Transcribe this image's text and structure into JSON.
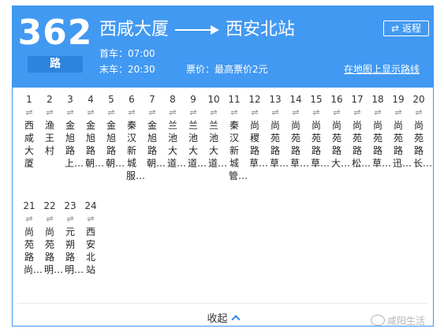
{
  "route": {
    "number": "362",
    "unit": "路"
  },
  "header": {
    "from": "西咸大厦",
    "to": "西安北站",
    "return_label": "返程",
    "return_icon": "swap-arrows-icon",
    "first_bus_label": "首车：",
    "first_bus_time": "07:00",
    "last_bus_label": "末车：",
    "last_bus_time": "20:30",
    "fare": "票价：最高票价2元",
    "map_link": "在地图上显示路线"
  },
  "stops": [
    {
      "num": "1",
      "dir": "⇌",
      "name": "西咸大厦"
    },
    {
      "num": "2",
      "dir": "⇌",
      "name": "渔王村"
    },
    {
      "num": "3",
      "dir": "⇌",
      "name": "金旭路上…"
    },
    {
      "num": "4",
      "dir": "⇌",
      "name": "金旭路朝…"
    },
    {
      "num": "5",
      "dir": "⇌",
      "name": "金旭路朝…"
    },
    {
      "num": "6",
      "dir": "⇌",
      "name": "秦汉新城服…"
    },
    {
      "num": "7",
      "dir": "⇌",
      "name": "金旭路朝…"
    },
    {
      "num": "8",
      "dir": "⇌",
      "name": "兰池大道…"
    },
    {
      "num": "9",
      "dir": "⇌",
      "name": "兰池大道…"
    },
    {
      "num": "10",
      "dir": "⇌",
      "name": "兰池大道…"
    },
    {
      "num": "11",
      "dir": "⇌",
      "name": "秦汉新城管…"
    },
    {
      "num": "12",
      "dir": "⇌",
      "name": "尚稷路草…"
    },
    {
      "num": "13",
      "dir": "⇌",
      "name": "尚苑路草…"
    },
    {
      "num": "14",
      "dir": "⇌",
      "name": "尚苑路草…"
    },
    {
      "num": "15",
      "dir": "⇌",
      "name": "尚苑路草…"
    },
    {
      "num": "16",
      "dir": "⇌",
      "name": "尚苑路大…"
    },
    {
      "num": "17",
      "dir": "⇌",
      "name": "尚苑路松…"
    },
    {
      "num": "18",
      "dir": "⇌",
      "name": "尚苑路草…"
    },
    {
      "num": "19",
      "dir": "⇌",
      "name": "尚苑路迅…"
    },
    {
      "num": "20",
      "dir": "⇌",
      "name": "尚苑路长…"
    },
    {
      "num": "21",
      "dir": "⇌",
      "name": "尚苑路尚…"
    },
    {
      "num": "22",
      "dir": "⇌",
      "name": "尚苑路明…"
    },
    {
      "num": "23",
      "dir": "⇌",
      "name": "元朔路明…"
    },
    {
      "num": "24",
      "dir": "⇌",
      "name": "西安北站"
    }
  ],
  "footer": {
    "collapse_label": "收起",
    "collapse_icon": "chevron-up-icon"
  },
  "watermark": {
    "text": "咸阳生活",
    "icon": "weibo-logo-icon"
  },
  "colors": {
    "header_bg": "#4299f2",
    "unit_bg": "#2d83dd",
    "border": "#3d96f0"
  }
}
